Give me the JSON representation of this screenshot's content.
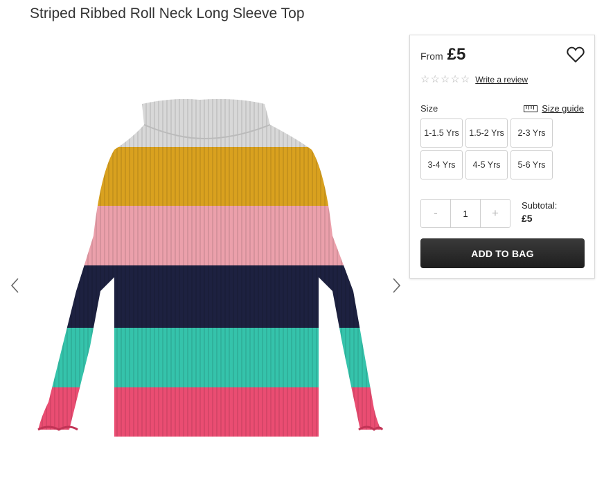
{
  "product": {
    "title": "Striped Ribbed Roll Neck Long Sleeve Top"
  },
  "pricing": {
    "from_label": "From",
    "price": "£5"
  },
  "rating": {
    "stars_filled": 0,
    "stars_total": 5,
    "review_link": "Write a review"
  },
  "size": {
    "label": "Size",
    "guide_label": "Size guide",
    "options": [
      "1-1.5 Yrs",
      "1.5-2 Yrs",
      "2-3 Yrs",
      "3-4 Yrs",
      "4-5 Yrs",
      "5-6 Yrs"
    ]
  },
  "quantity": {
    "minus": "-",
    "value": "1",
    "plus": "+"
  },
  "subtotal": {
    "label": "Subtotal:",
    "value": "£5"
  },
  "actions": {
    "add_to_bag": "ADD TO BAG"
  },
  "icons": {
    "wishlist": "heart-icon",
    "size_guide": "ruler-icon",
    "prev": "chevron-left-icon",
    "next": "chevron-right-icon",
    "star": "star-outline-icon"
  },
  "colors": {
    "button_bg": "#2b2b2b",
    "stripe_grey": "#d9d9d9",
    "stripe_mustard": "#d9a11f",
    "stripe_pink": "#eba0ab",
    "stripe_navy": "#1d2140",
    "stripe_teal": "#35c3ab",
    "stripe_coral": "#ea4d72"
  }
}
